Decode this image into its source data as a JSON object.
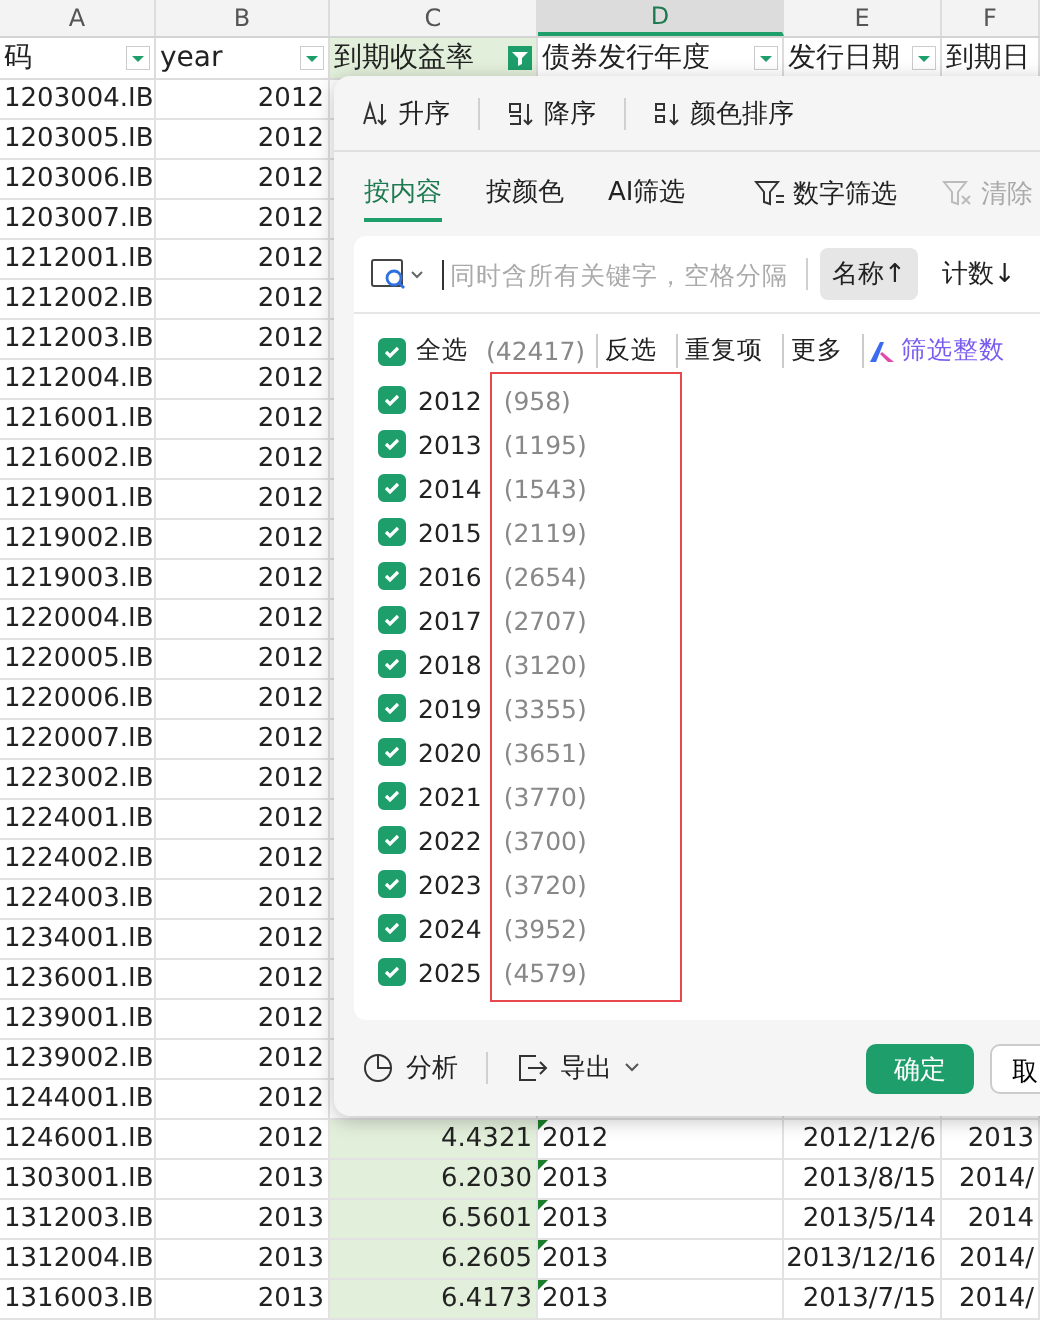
{
  "columns": [
    {
      "letter": "A",
      "selected": false
    },
    {
      "letter": "B",
      "selected": false
    },
    {
      "letter": "C",
      "selected": false
    },
    {
      "letter": "D",
      "selected": true
    },
    {
      "letter": "E",
      "selected": false
    },
    {
      "letter": "F",
      "selected": false
    }
  ],
  "headers": [
    {
      "label": "码",
      "kind": "dropdown"
    },
    {
      "label": "year",
      "kind": "dropdown"
    },
    {
      "label": "到期收益率",
      "kind": "filtered"
    },
    {
      "label": "债券发行年度",
      "kind": "dropdown"
    },
    {
      "label": "发行日期",
      "kind": "dropdown"
    },
    {
      "label": "到期日",
      "kind": "plain"
    }
  ],
  "rows": [
    {
      "cells": [
        "1203004.IB",
        "2012"
      ]
    },
    {
      "cells": [
        "1203005.IB",
        "2012"
      ]
    },
    {
      "cells": [
        "1203006.IB",
        "2012"
      ]
    },
    {
      "cells": [
        "1203007.IB",
        "2012"
      ]
    },
    {
      "cells": [
        "1212001.IB",
        "2012"
      ]
    },
    {
      "cells": [
        "1212002.IB",
        "2012"
      ]
    },
    {
      "cells": [
        "1212003.IB",
        "2012"
      ]
    },
    {
      "cells": [
        "1212004.IB",
        "2012"
      ]
    },
    {
      "cells": [
        "1216001.IB",
        "2012"
      ]
    },
    {
      "cells": [
        "1216002.IB",
        "2012"
      ]
    },
    {
      "cells": [
        "1219001.IB",
        "2012"
      ]
    },
    {
      "cells": [
        "1219002.IB",
        "2012"
      ]
    },
    {
      "cells": [
        "1219003.IB",
        "2012"
      ]
    },
    {
      "cells": [
        "1220004.IB",
        "2012"
      ]
    },
    {
      "cells": [
        "1220005.IB",
        "2012"
      ]
    },
    {
      "cells": [
        "1220006.IB",
        "2012"
      ]
    },
    {
      "cells": [
        "1220007.IB",
        "2012"
      ]
    },
    {
      "cells": [
        "1223002.IB",
        "2012"
      ]
    },
    {
      "cells": [
        "1224001.IB",
        "2012"
      ]
    },
    {
      "cells": [
        "1224002.IB",
        "2012"
      ]
    },
    {
      "cells": [
        "1224003.IB",
        "2012"
      ]
    },
    {
      "cells": [
        "1234001.IB",
        "2012"
      ]
    },
    {
      "cells": [
        "1236001.IB",
        "2012"
      ]
    },
    {
      "cells": [
        "1239001.IB",
        "2012"
      ]
    },
    {
      "cells": [
        "1239002.IB",
        "2012"
      ]
    },
    {
      "cells": [
        "1244001.IB",
        "2012"
      ]
    },
    {
      "cells": [
        "1246001.IB",
        "2012",
        "4.4321",
        "2012",
        "2012/12/6",
        "2013"
      ],
      "text_flag": true
    },
    {
      "cells": [
        "1303001.IB",
        "2013",
        "6.2030",
        "2013",
        "2013/8/15",
        "2014/"
      ],
      "text_flag": true
    },
    {
      "cells": [
        "1312003.IB",
        "2013",
        "6.5601",
        "2013",
        "2013/5/14",
        "2014"
      ],
      "text_flag": true
    },
    {
      "cells": [
        "1312004.IB",
        "2013",
        "6.2605",
        "2013",
        "2013/12/16",
        "2014/"
      ],
      "text_flag": true
    },
    {
      "cells": [
        "1316003.IB",
        "2013",
        "6.4173",
        "2013",
        "2013/7/15",
        "2014/"
      ],
      "text_flag": true
    }
  ],
  "filter_panel": {
    "sort_buttons": [
      {
        "label": "升序",
        "kind": "asc"
      },
      {
        "label": "降序",
        "kind": "desc"
      },
      {
        "label": "颜色排序",
        "kind": "color"
      }
    ],
    "tabs": [
      {
        "label": "按内容",
        "selected": true
      },
      {
        "label": "按颜色",
        "selected": false
      },
      {
        "label": "AI筛选",
        "selected": false
      }
    ],
    "number_filter": "数字筛选",
    "clear_filter": {
      "label": "清除",
      "disabled": true
    },
    "search": {
      "placeholder": "同时含所有关键字，空格分隔"
    },
    "sort_options": [
      {
        "label": "名称↑",
        "selected": true
      },
      {
        "label": "计数↓",
        "selected": false
      }
    ],
    "select_all": {
      "label": "全选",
      "count": "(42417)",
      "checked": true
    },
    "actions": [
      "反选",
      "重复项",
      "更多"
    ],
    "ai_action": "筛选整数",
    "items": [
      {
        "label": "2012",
        "count": "(958)",
        "checked": true
      },
      {
        "label": "2013",
        "count": "(1195)",
        "checked": true
      },
      {
        "label": "2014",
        "count": "(1543)",
        "checked": true
      },
      {
        "label": "2015",
        "count": "(2119)",
        "checked": true
      },
      {
        "label": "2016",
        "count": "(2654)",
        "checked": true
      },
      {
        "label": "2017",
        "count": "(2707)",
        "checked": true
      },
      {
        "label": "2018",
        "count": "(3120)",
        "checked": true
      },
      {
        "label": "2019",
        "count": "(3355)",
        "checked": true
      },
      {
        "label": "2020",
        "count": "(3651)",
        "checked": true
      },
      {
        "label": "2021",
        "count": "(3770)",
        "checked": true
      },
      {
        "label": "2022",
        "count": "(3700)",
        "checked": true
      },
      {
        "label": "2023",
        "count": "(3720)",
        "checked": true
      },
      {
        "label": "2024",
        "count": "(3952)",
        "checked": true
      },
      {
        "label": "2025",
        "count": "(4579)",
        "checked": true
      }
    ],
    "footer": {
      "analyze": "分析",
      "export": "导出",
      "ok": "确定",
      "cancel": "取"
    }
  }
}
